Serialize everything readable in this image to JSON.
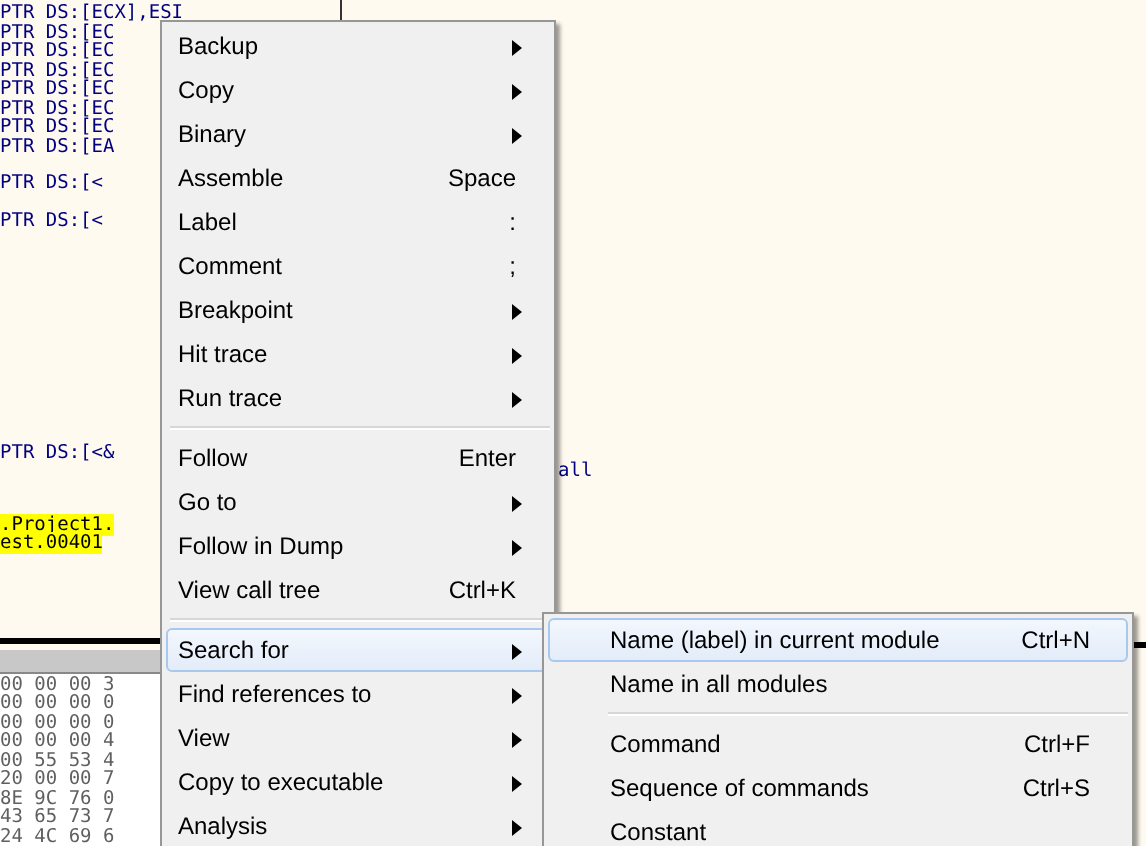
{
  "disassembly": {
    "lines": [
      "PTR DS:[ECX],ESI",
      "PTR DS:[EC",
      "PTR DS:[EC",
      "PTR DS:[EC",
      "PTR DS:[EC",
      "PTR DS:[EC",
      "PTR DS:[EC",
      "PTR DS:[EA"
    ],
    "lines_mid": [
      "PTR DS:[<",
      "PTR DS:[<"
    ],
    "lines_lower": [
      "PTR DS:[<&"
    ],
    "highlighted_lines": [
      ".Project1.",
      "est.00401"
    ],
    "right_text": "all"
  },
  "dump": {
    "rows": [
      "00 00 00 3",
      "00 00 00 0",
      "00 00 00 0",
      "00 00 00 4",
      "00 55 53 4",
      "20 00 00 7",
      "8E 9C 76 0",
      "43 65 73 7",
      "24 4C 69 6"
    ]
  },
  "context_menu": {
    "items": [
      {
        "kind": "submenu",
        "label": "Backup",
        "selected": false
      },
      {
        "kind": "submenu",
        "label": "Copy",
        "selected": false
      },
      {
        "kind": "submenu",
        "label": "Binary",
        "selected": false
      },
      {
        "kind": "shortcut",
        "label": "Assemble",
        "shortcut": "Space",
        "selected": false
      },
      {
        "kind": "shortcut",
        "label": "Label",
        "shortcut": ":",
        "selected": false
      },
      {
        "kind": "shortcut",
        "label": "Comment",
        "shortcut": ";",
        "selected": false
      },
      {
        "kind": "submenu",
        "label": "Breakpoint",
        "selected": false
      },
      {
        "kind": "submenu",
        "label": "Hit trace",
        "selected": false
      },
      {
        "kind": "submenu",
        "label": "Run trace",
        "selected": false
      },
      {
        "kind": "separator"
      },
      {
        "kind": "shortcut",
        "label": "Follow",
        "shortcut": "Enter",
        "selected": false
      },
      {
        "kind": "submenu",
        "label": "Go to",
        "selected": false
      },
      {
        "kind": "submenu",
        "label": "Follow in Dump",
        "selected": false
      },
      {
        "kind": "shortcut",
        "label": "View call tree",
        "shortcut": "Ctrl+K",
        "selected": false
      },
      {
        "kind": "separator"
      },
      {
        "kind": "submenu",
        "label": "Search for",
        "selected": true
      },
      {
        "kind": "submenu",
        "label": "Find references to",
        "selected": false
      },
      {
        "kind": "submenu",
        "label": "View",
        "selected": false
      },
      {
        "kind": "submenu",
        "label": "Copy to executable",
        "selected": false
      },
      {
        "kind": "submenu",
        "label": "Analysis",
        "selected": false
      }
    ]
  },
  "submenu": {
    "items": [
      {
        "kind": "shortcut",
        "label": "Name (label) in current module",
        "shortcut": "Ctrl+N",
        "selected": true
      },
      {
        "kind": "shortcut",
        "label": "Name in all modules",
        "selected": false
      },
      {
        "kind": "separator"
      },
      {
        "kind": "shortcut",
        "label": "Command",
        "shortcut": "Ctrl+F",
        "selected": false
      },
      {
        "kind": "shortcut",
        "label": "Sequence of commands",
        "shortcut": "Ctrl+S",
        "selected": false
      },
      {
        "kind": "shortcut",
        "label": "Constant",
        "selected": false
      }
    ]
  }
}
